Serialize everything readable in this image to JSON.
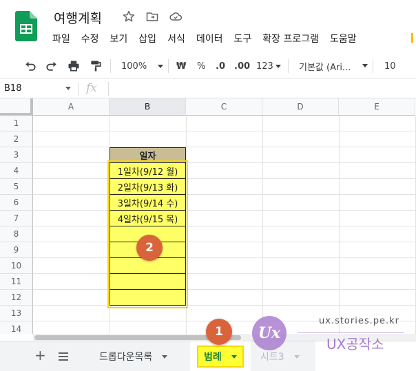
{
  "app": {
    "doc_title": "여행계획",
    "menu": [
      "파일",
      "수정",
      "보기",
      "삽입",
      "서식",
      "데이터",
      "도구",
      "확장 프로그램",
      "도움말"
    ]
  },
  "toolbar": {
    "zoom": "100%",
    "currency": "₩",
    "percent": "%",
    "dec_decrease": ".0",
    "dec_increase": ".00",
    "more_formats": "123",
    "font": "기본값 (Ari...",
    "font_size": "10"
  },
  "formula_bar": {
    "name_box": "B18",
    "fx": "fx",
    "value": ""
  },
  "grid": {
    "columns": [
      "A",
      "B",
      "C",
      "D",
      "E"
    ],
    "rows": [
      "1",
      "2",
      "3",
      "4",
      "5",
      "6",
      "7",
      "8",
      "9",
      "10",
      "11",
      "12",
      "13",
      "14"
    ],
    "b_header": "일자",
    "b_values": [
      "1일차(9/12 월)",
      "2일차(9/13 화)",
      "3일차(9/14 수)",
      "4일차(9/15 목)",
      "",
      "",
      "",
      "",
      ""
    ]
  },
  "badges": {
    "one": "1",
    "two": "2"
  },
  "sheets": {
    "tabs": [
      {
        "label": "드롭다운목록",
        "active": false
      },
      {
        "label": "범례",
        "active": true
      },
      {
        "label": "시트3",
        "active": false
      }
    ]
  },
  "watermark": {
    "url": "ux.stories.pe.kr",
    "logo": "Ux",
    "name": "UX공작소"
  },
  "colors": {
    "yellow_fill": "#ffff66",
    "header_fill": "#c8bd94",
    "highlight_border": "#f5d80b",
    "badge": "#d9633a",
    "sheets_green": "#188038"
  }
}
